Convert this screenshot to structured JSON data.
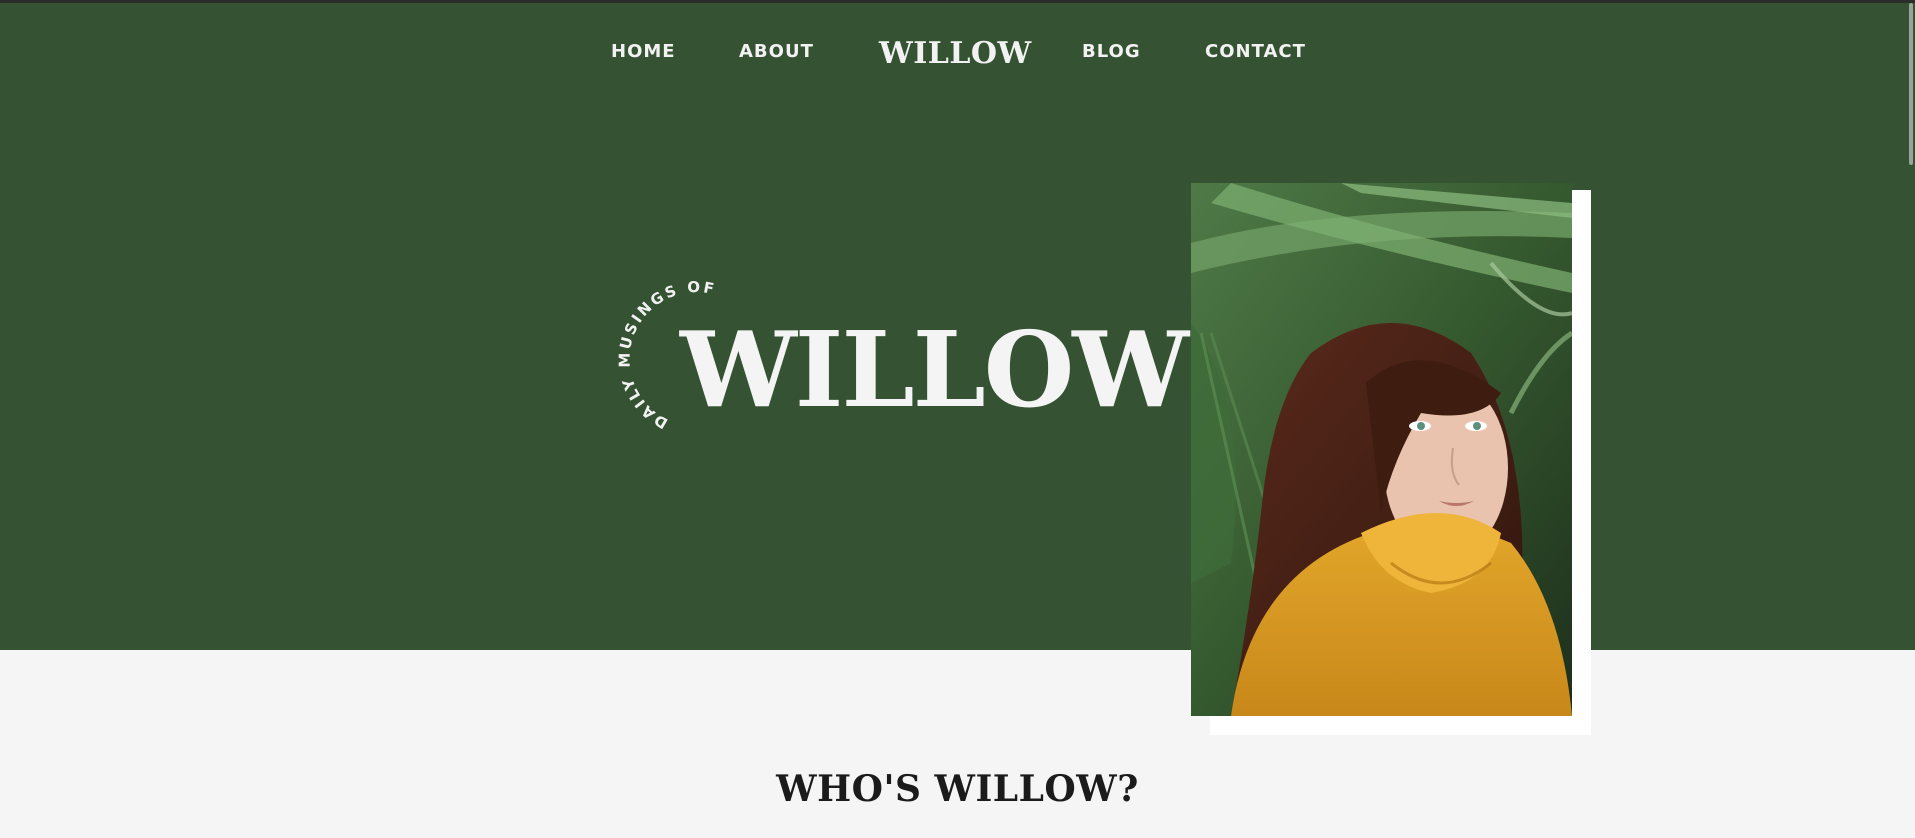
{
  "nav": {
    "home": "HOME",
    "about": "ABOUT",
    "logo": "WILLOW",
    "blog": "BLOG",
    "contact": "CONTACT"
  },
  "hero": {
    "arc_text": "DAILY MUSINGS OF",
    "title": "WILLOW"
  },
  "section": {
    "title": "WHO'S WILLOW?"
  },
  "colors": {
    "hero_bg": "#355333",
    "page_bg": "#f5f5f5",
    "text_light": "#f2f2f2",
    "text_dark": "#1b1b1b"
  }
}
